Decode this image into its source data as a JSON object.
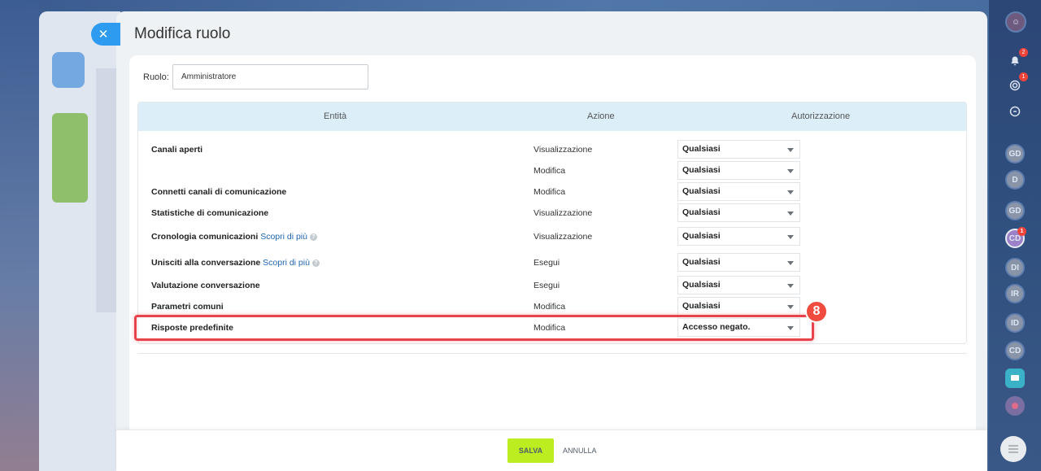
{
  "slider": {
    "title": "Modifica ruolo",
    "close_icon": "close-icon"
  },
  "role": {
    "label": "Ruolo:",
    "value": "Amministratore"
  },
  "table": {
    "headers": [
      "Entità",
      "Azione",
      "Autorizzazione"
    ],
    "rows": [
      {
        "entity": "Canali aperti",
        "more": "",
        "action": "Visualizzazione",
        "permission": "Qualsiasi"
      },
      {
        "entity": "",
        "more": "",
        "action": "Modifica",
        "permission": "Qualsiasi"
      },
      {
        "entity": "Connetti canali di comunicazione",
        "more": "",
        "action": "Modifica",
        "permission": "Qualsiasi"
      },
      {
        "entity": "Statistiche di comunicazione",
        "more": "",
        "action": "Visualizzazione",
        "permission": "Qualsiasi"
      },
      {
        "entity": "Cronologia comunicazioni",
        "more": "Scopri di più",
        "action": "Visualizzazione",
        "permission": "Qualsiasi"
      },
      {
        "entity": "Unisciti alla conversazione",
        "more": "Scopri di più",
        "action": "Esegui",
        "permission": "Qualsiasi"
      },
      {
        "entity": "Valutazione conversazione",
        "more": "",
        "action": "Esegui",
        "permission": "Qualsiasi"
      },
      {
        "entity": "Parametri comuni",
        "more": "",
        "action": "Modifica",
        "permission": "Qualsiasi"
      },
      {
        "entity": "Risposte predefinite",
        "more": "",
        "action": "Modifica",
        "permission": "Accesso negato."
      }
    ]
  },
  "annotation": {
    "step_number": "8",
    "color": "#ef4b3f"
  },
  "footer": {
    "save_label": "SALVA",
    "cancel_label": "ANNULLA"
  },
  "rail": {
    "badges": [
      "2",
      "1",
      "1"
    ],
    "avatars": [
      "GD",
      "D",
      "GD",
      "CD",
      "DI",
      "IR",
      "ID",
      "CD"
    ]
  },
  "colors": {
    "accent": "#2d9cf0",
    "save": "#bbed21",
    "header_bg": "#dceff9",
    "link": "#2067b0"
  }
}
